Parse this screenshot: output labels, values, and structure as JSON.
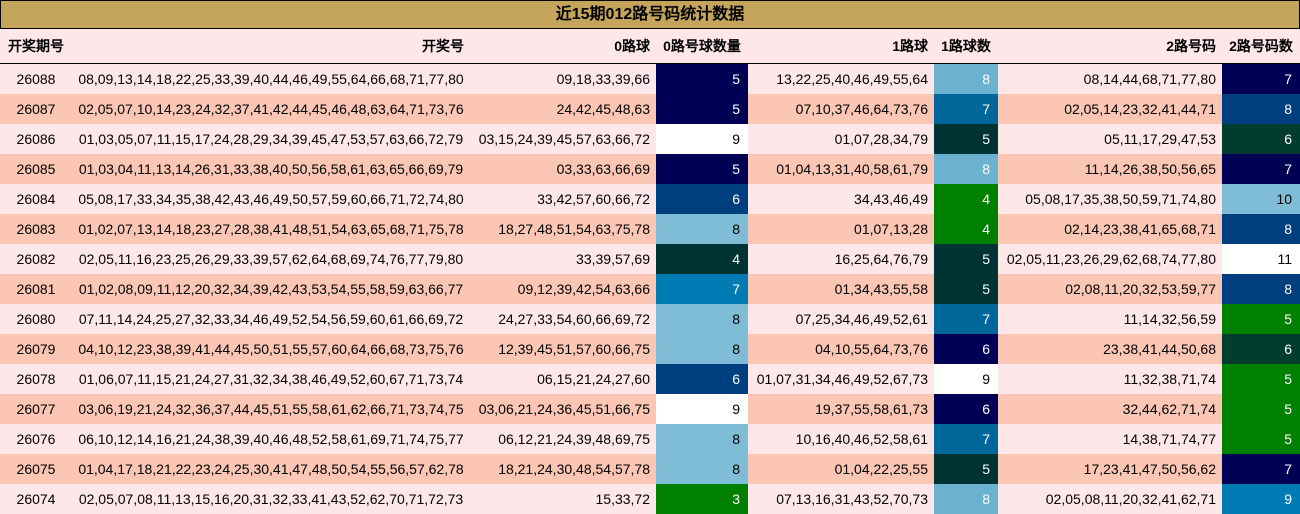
{
  "title": "近15期012路号码统计数据",
  "headers": [
    "开奖期号",
    "开奖号",
    "0路球",
    "0路号球数量",
    "1路球",
    "1路球数",
    "2路号码",
    "2路号码数"
  ],
  "colors": {
    "3": {
      "bg": "#008000",
      "fg": "#ffffff"
    },
    "4": {
      "bg": "#008000",
      "fg": "#ffffff"
    },
    "5": {
      "bg": "#000066",
      "fg": "#ffffff"
    },
    "6": {
      "bg": "#003f7f",
      "fg": "#ffffff"
    },
    "7": {
      "bg": "#007bb3",
      "fg": "#ffffff"
    },
    "8": {
      "bg": "#7fbcd6",
      "fg": "#000000"
    },
    "9": {
      "bg": "#ffffff",
      "fg": "#000000"
    }
  },
  "rows": [
    {
      "issue": "26088",
      "numbers": "08,09,13,14,18,22,25,33,39,40,44,46,49,55,64,66,68,71,77,80",
      "r0": "09,18,33,39,66",
      "r0c": "5",
      "r0c_bg": "#000055",
      "r0c_fg": "#ffffff",
      "r1": "13,22,25,40,46,49,55,64",
      "r1c": "8",
      "r1c_bg": "#6bb2d0",
      "r1c_fg": "#ffffff",
      "r2": "08,14,44,68,71,77,80",
      "r2c": "7",
      "r2c_bg": "#000055",
      "r2c_fg": "#ffffff"
    },
    {
      "issue": "26087",
      "numbers": "02,05,07,10,14,23,24,32,37,41,42,44,45,46,48,63,64,71,73,76",
      "r0": "24,42,45,48,63",
      "r0c": "5",
      "r0c_bg": "#000055",
      "r0c_fg": "#ffffff",
      "r1": "07,10,37,46,64,73,76",
      "r1c": "7",
      "r1c_bg": "#00679a",
      "r1c_fg": "#ffffff",
      "r2": "02,05,14,23,32,41,44,71",
      "r2c": "8",
      "r2c_bg": "#003f7f",
      "r2c_fg": "#ffffff"
    },
    {
      "issue": "26086",
      "numbers": "01,03,05,07,11,15,17,24,28,29,34,39,45,47,53,57,63,66,72,79",
      "r0": "03,15,24,39,45,57,63,66,72",
      "r0c": "9",
      "r0c_bg": "#ffffff",
      "r0c_fg": "#000000",
      "r1": "01,07,28,34,79",
      "r1c": "5",
      "r1c_bg": "#003333",
      "r1c_fg": "#ffffff",
      "r2": "05,11,17,29,47,53",
      "r2c": "6",
      "r2c_bg": "#003d2e",
      "r2c_fg": "#ffffff"
    },
    {
      "issue": "26085",
      "numbers": "01,03,04,11,13,14,26,31,33,38,40,50,56,58,61,63,65,66,69,79",
      "r0": "03,33,63,66,69",
      "r0c": "5",
      "r0c_bg": "#000055",
      "r0c_fg": "#ffffff",
      "r1": "01,04,13,31,40,58,61,79",
      "r1c": "8",
      "r1c_bg": "#6bb2d0",
      "r1c_fg": "#ffffff",
      "r2": "11,14,26,38,50,56,65",
      "r2c": "7",
      "r2c_bg": "#000055",
      "r2c_fg": "#ffffff"
    },
    {
      "issue": "26084",
      "numbers": "05,08,17,33,34,35,38,42,43,46,49,50,57,59,60,66,71,72,74,80",
      "r0": "33,42,57,60,66,72",
      "r0c": "6",
      "r0c_bg": "#003f7f",
      "r0c_fg": "#ffffff",
      "r1": "34,43,46,49",
      "r1c": "4",
      "r1c_bg": "#008000",
      "r1c_fg": "#ffffff",
      "r2": "05,08,17,35,38,50,59,71,74,80",
      "r2c": "10",
      "r2c_bg": "#7fbcd6",
      "r2c_fg": "#000000"
    },
    {
      "issue": "26083",
      "numbers": "01,02,07,13,14,18,23,27,28,38,41,48,51,54,63,65,68,71,75,78",
      "r0": "18,27,48,51,54,63,75,78",
      "r0c": "8",
      "r0c_bg": "#7fbcd6",
      "r0c_fg": "#000000",
      "r1": "01,07,13,28",
      "r1c": "4",
      "r1c_bg": "#008000",
      "r1c_fg": "#ffffff",
      "r2": "02,14,23,38,41,65,68,71",
      "r2c": "8",
      "r2c_bg": "#003f7f",
      "r2c_fg": "#ffffff"
    },
    {
      "issue": "26082",
      "numbers": "02,05,11,16,23,25,26,29,33,39,57,62,64,68,69,74,76,77,79,80",
      "r0": "33,39,57,69",
      "r0c": "4",
      "r0c_bg": "#003333",
      "r0c_fg": "#ffffff",
      "r1": "16,25,64,76,79",
      "r1c": "5",
      "r1c_bg": "#003333",
      "r1c_fg": "#ffffff",
      "r2": "02,05,11,23,26,29,62,68,74,77,80",
      "r2c": "11",
      "r2c_bg": "#ffffff",
      "r2c_fg": "#000000"
    },
    {
      "issue": "26081",
      "numbers": "01,02,08,09,11,12,20,32,34,39,42,43,53,54,55,58,59,63,66,77",
      "r0": "09,12,39,42,54,63,66",
      "r0c": "7",
      "r0c_bg": "#007bb3",
      "r0c_fg": "#ffffff",
      "r1": "01,34,43,55,58",
      "r1c": "5",
      "r1c_bg": "#003333",
      "r1c_fg": "#ffffff",
      "r2": "02,08,11,20,32,53,59,77",
      "r2c": "8",
      "r2c_bg": "#003f7f",
      "r2c_fg": "#ffffff"
    },
    {
      "issue": "26080",
      "numbers": "07,11,14,24,25,27,32,33,34,46,49,52,54,56,59,60,61,66,69,72",
      "r0": "24,27,33,54,60,66,69,72",
      "r0c": "8",
      "r0c_bg": "#7fbcd6",
      "r0c_fg": "#000000",
      "r1": "07,25,34,46,49,52,61",
      "r1c": "7",
      "r1c_bg": "#00679a",
      "r1c_fg": "#ffffff",
      "r2": "11,14,32,56,59",
      "r2c": "5",
      "r2c_bg": "#008000",
      "r2c_fg": "#ffffff"
    },
    {
      "issue": "26079",
      "numbers": "04,10,12,23,38,39,41,44,45,50,51,55,57,60,64,66,68,73,75,76",
      "r0": "12,39,45,51,57,60,66,75",
      "r0c": "8",
      "r0c_bg": "#7fbcd6",
      "r0c_fg": "#000000",
      "r1": "04,10,55,64,73,76",
      "r1c": "6",
      "r1c_bg": "#000055",
      "r1c_fg": "#ffffff",
      "r2": "23,38,41,44,50,68",
      "r2c": "6",
      "r2c_bg": "#003d2e",
      "r2c_fg": "#ffffff"
    },
    {
      "issue": "26078",
      "numbers": "01,06,07,11,15,21,24,27,31,32,34,38,46,49,52,60,67,71,73,74",
      "r0": "06,15,21,24,27,60",
      "r0c": "6",
      "r0c_bg": "#003f7f",
      "r0c_fg": "#ffffff",
      "r1": "01,07,31,34,46,49,52,67,73",
      "r1c": "9",
      "r1c_bg": "#ffffff",
      "r1c_fg": "#000000",
      "r2": "11,32,38,71,74",
      "r2c": "5",
      "r2c_bg": "#008000",
      "r2c_fg": "#ffffff"
    },
    {
      "issue": "26077",
      "numbers": "03,06,19,21,24,32,36,37,44,45,51,55,58,61,62,66,71,73,74,75",
      "r0": "03,06,21,24,36,45,51,66,75",
      "r0c": "9",
      "r0c_bg": "#ffffff",
      "r0c_fg": "#000000",
      "r1": "19,37,55,58,61,73",
      "r1c": "6",
      "r1c_bg": "#000055",
      "r1c_fg": "#ffffff",
      "r2": "32,44,62,71,74",
      "r2c": "5",
      "r2c_bg": "#008000",
      "r2c_fg": "#ffffff"
    },
    {
      "issue": "26076",
      "numbers": "06,10,12,14,16,21,24,38,39,40,46,48,52,58,61,69,71,74,75,77",
      "r0": "06,12,21,24,39,48,69,75",
      "r0c": "8",
      "r0c_bg": "#7fbcd6",
      "r0c_fg": "#000000",
      "r1": "10,16,40,46,52,58,61",
      "r1c": "7",
      "r1c_bg": "#00679a",
      "r1c_fg": "#ffffff",
      "r2": "14,38,71,74,77",
      "r2c": "5",
      "r2c_bg": "#008000",
      "r2c_fg": "#ffffff"
    },
    {
      "issue": "26075",
      "numbers": "01,04,17,18,21,22,23,24,25,30,41,47,48,50,54,55,56,57,62,78",
      "r0": "18,21,24,30,48,54,57,78",
      "r0c": "8",
      "r0c_bg": "#7fbcd6",
      "r0c_fg": "#000000",
      "r1": "01,04,22,25,55",
      "r1c": "5",
      "r1c_bg": "#003333",
      "r1c_fg": "#ffffff",
      "r2": "17,23,41,47,50,56,62",
      "r2c": "7",
      "r2c_bg": "#000055",
      "r2c_fg": "#ffffff"
    },
    {
      "issue": "26074",
      "numbers": "02,05,07,08,11,13,15,16,20,31,32,33,41,43,52,62,70,71,72,73",
      "r0": "15,33,72",
      "r0c": "3",
      "r0c_bg": "#008000",
      "r0c_fg": "#ffffff",
      "r1": "07,13,16,31,43,52,70,73",
      "r1c": "8",
      "r1c_bg": "#6bb2d0",
      "r1c_fg": "#ffffff",
      "r2": "02,05,08,11,20,32,41,62,71",
      "r2c": "9",
      "r2c_bg": "#007bb3",
      "r2c_fg": "#ffffff"
    }
  ]
}
